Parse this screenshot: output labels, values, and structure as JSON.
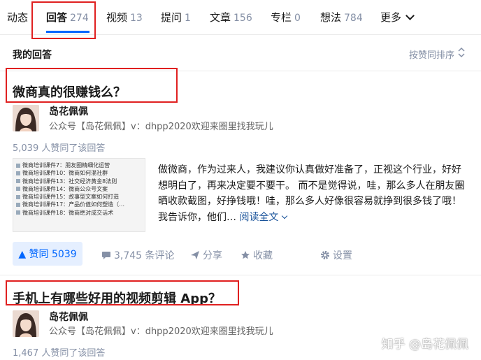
{
  "tabs": [
    {
      "label": "动态",
      "count": ""
    },
    {
      "label": "回答",
      "count": "274"
    },
    {
      "label": "视频",
      "count": "13"
    },
    {
      "label": "提问",
      "count": "1"
    },
    {
      "label": "文章",
      "count": "156"
    },
    {
      "label": "专栏",
      "count": "0"
    },
    {
      "label": "想法",
      "count": "784"
    },
    {
      "label": "更多",
      "count": ""
    }
  ],
  "section": {
    "title": "我的回答",
    "sort_label": "按赞同排序"
  },
  "answers": [
    {
      "question": "微商真的很赚钱么？",
      "author": "岛花佩佩",
      "headline": "公众号【岛花佩佩】v：dhpp2020欢迎来圈里找我玩儿",
      "votes": "5,039 人赞同了该回答",
      "thumb_lines": [
        "微商培训课件7：朋友圈精细化运营",
        "微商培训课件10：微商如何混社群",
        "微商培训课件13：社交经济黄金8法则",
        "微商培训课件14：微商公众号文案",
        "微商培训课件15：故事型文案如何打造",
        "微商培训课件17：产品价值如何塑造（…",
        "微商培训课件18：微商绝对成交话术"
      ],
      "excerpt": "做微商，作为过来人，我建议你认真做好准备了，正视这个行业，好好想明白了，再来决定要不要干。 而不是觉得说，哇，那么多人在朋友圈晒收款截图，好挣钱哦！哇，那么多人好像很容易就挣到很多钱了哦！我告诉你，他们…",
      "read_more": "阅读全文",
      "upvote": "▲ 赞同 5039",
      "comments": "3,745 条评论",
      "share": "分享",
      "collect": "收藏",
      "settings": "设置"
    },
    {
      "question": "手机上有哪些好用的视频剪辑 App？",
      "author": "岛花佩佩",
      "headline": "公众号【岛花佩佩】v：dhpp2020欢迎来圈里找我玩儿",
      "votes": "1,467 人赞同了该回答"
    }
  ],
  "watermark": "知乎 @岛花佩佩",
  "colors": {
    "accent": "#0066ff",
    "highlight": "#e02020",
    "muted": "#8590a6",
    "link": "#175199"
  }
}
